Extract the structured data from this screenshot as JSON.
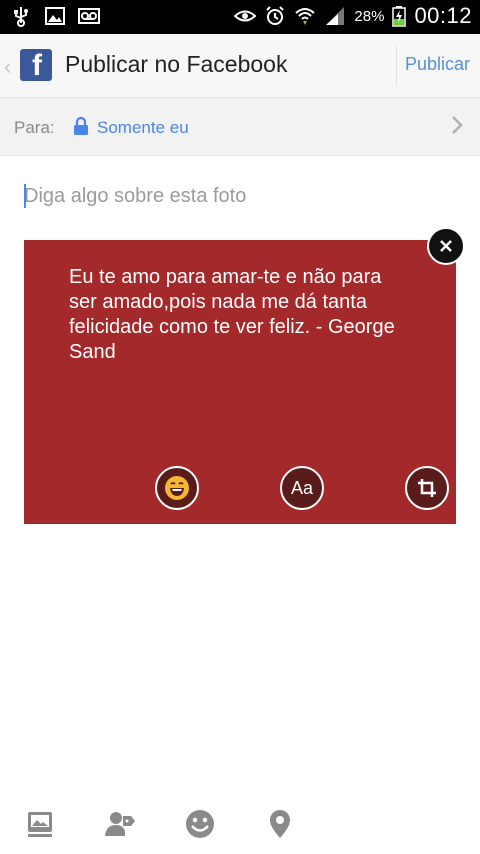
{
  "status_bar": {
    "battery_percent": "28%",
    "time": "00:12"
  },
  "header": {
    "title": "Publicar no Facebook",
    "publish_label": "Publicar"
  },
  "audience": {
    "label": "Para:",
    "value": "Somente eu"
  },
  "composer": {
    "placeholder": "Diga algo sobre esta foto"
  },
  "card": {
    "quote": "Eu te amo para amar-te e não para ser amado,pois nada me dá tanta felicidade como te ver feliz. - George Sand",
    "background": "#a3292b",
    "text_tool_label": "Aa"
  },
  "colors": {
    "link": "#4a86e8",
    "brand": "#3b5998"
  }
}
